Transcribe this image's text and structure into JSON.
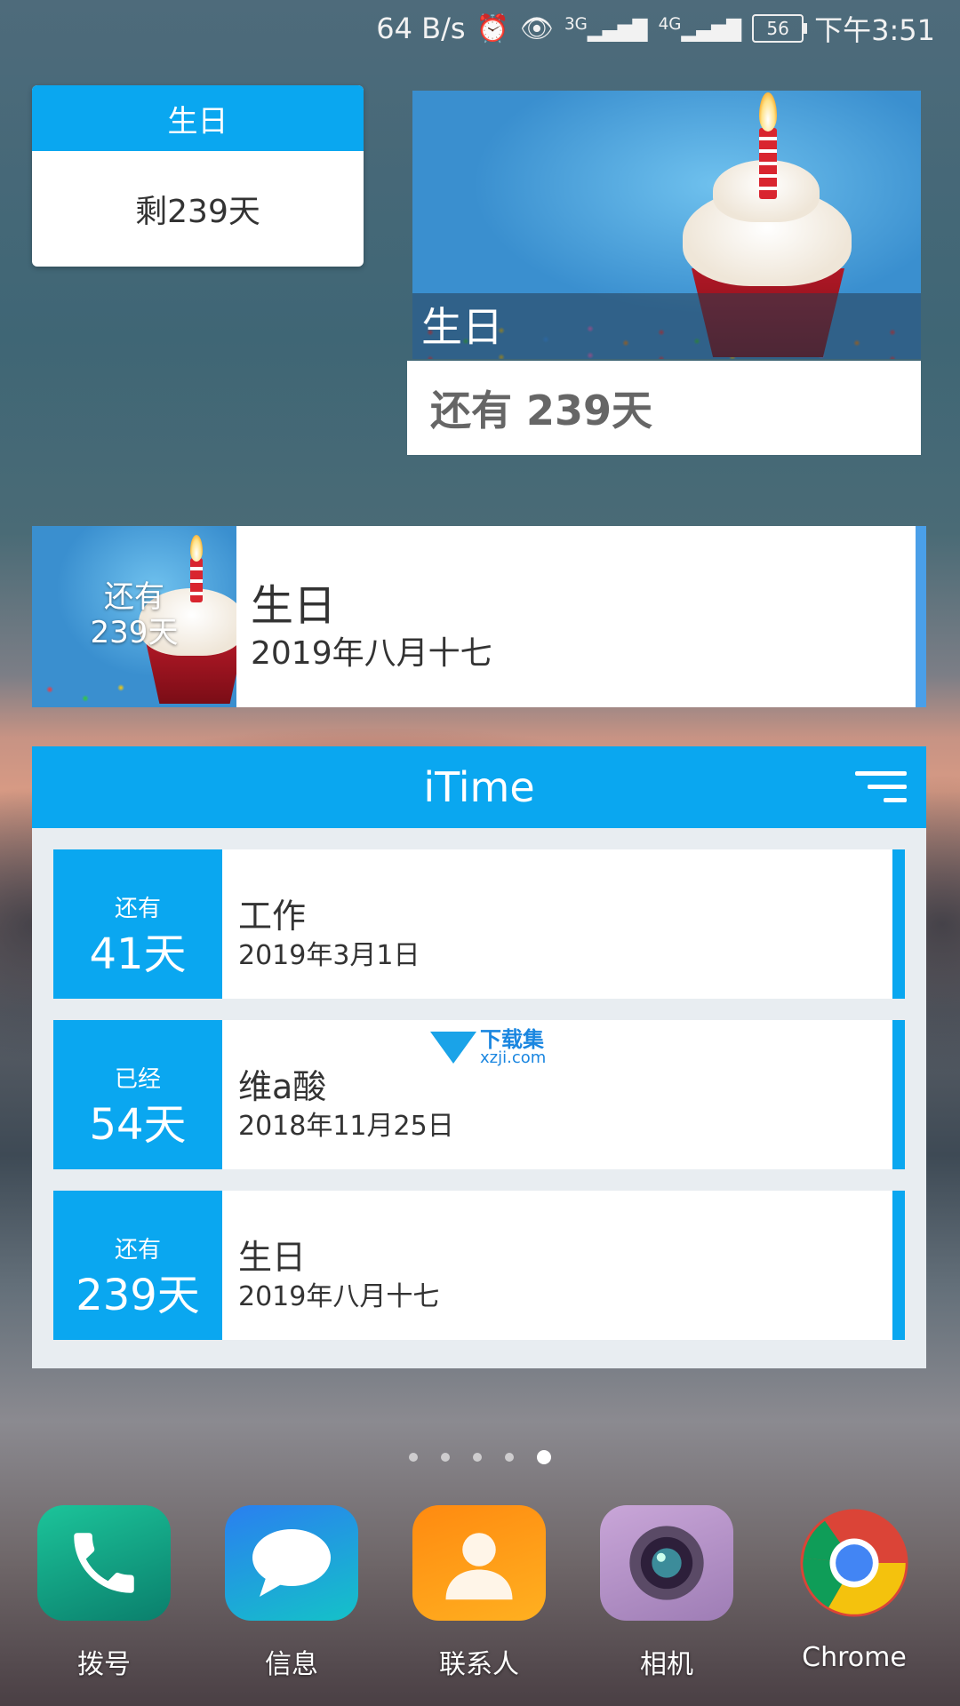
{
  "status_bar": {
    "net_speed": "64 B/s",
    "alarm_icon": "alarm-icon",
    "eye_icon": "eye-icon",
    "sig1": "3G",
    "sig2": "4G",
    "battery": "56",
    "time": "下午3:51"
  },
  "widget_small": {
    "title": "生日",
    "remaining": "剩239天"
  },
  "widget_photo": {
    "title": "生日",
    "remaining": "还有 239天"
  },
  "widget_wide": {
    "badge_line1": "还有",
    "badge_line2": "239天",
    "name": "生日",
    "date": "2019年八月十七"
  },
  "itime": {
    "title": "iTime",
    "rows": [
      {
        "label": "还有",
        "count": "41天",
        "name": "工作",
        "date": "2019年3月1日"
      },
      {
        "label": "已经",
        "count": "54天",
        "name": "维a酸",
        "date": "2018年11月25日"
      },
      {
        "label": "还有",
        "count": "239天",
        "name": "生日",
        "date": "2019年八月十七"
      }
    ]
  },
  "watermark": {
    "line1": "下载集",
    "line2": "xzji.com"
  },
  "pages": {
    "count": 5,
    "active": 5
  },
  "dock": [
    {
      "label": "拨号",
      "icon": "phone-icon",
      "color": "#16a889"
    },
    {
      "label": "信息",
      "icon": "message-icon",
      "color": "#1a8ee8"
    },
    {
      "label": "联系人",
      "icon": "contacts-icon",
      "color": "#ff9a14"
    },
    {
      "label": "相机",
      "icon": "camera-icon",
      "color": "#b88fc4"
    },
    {
      "label": "Chrome",
      "icon": "chrome-icon",
      "color": "#4285f4"
    }
  ]
}
